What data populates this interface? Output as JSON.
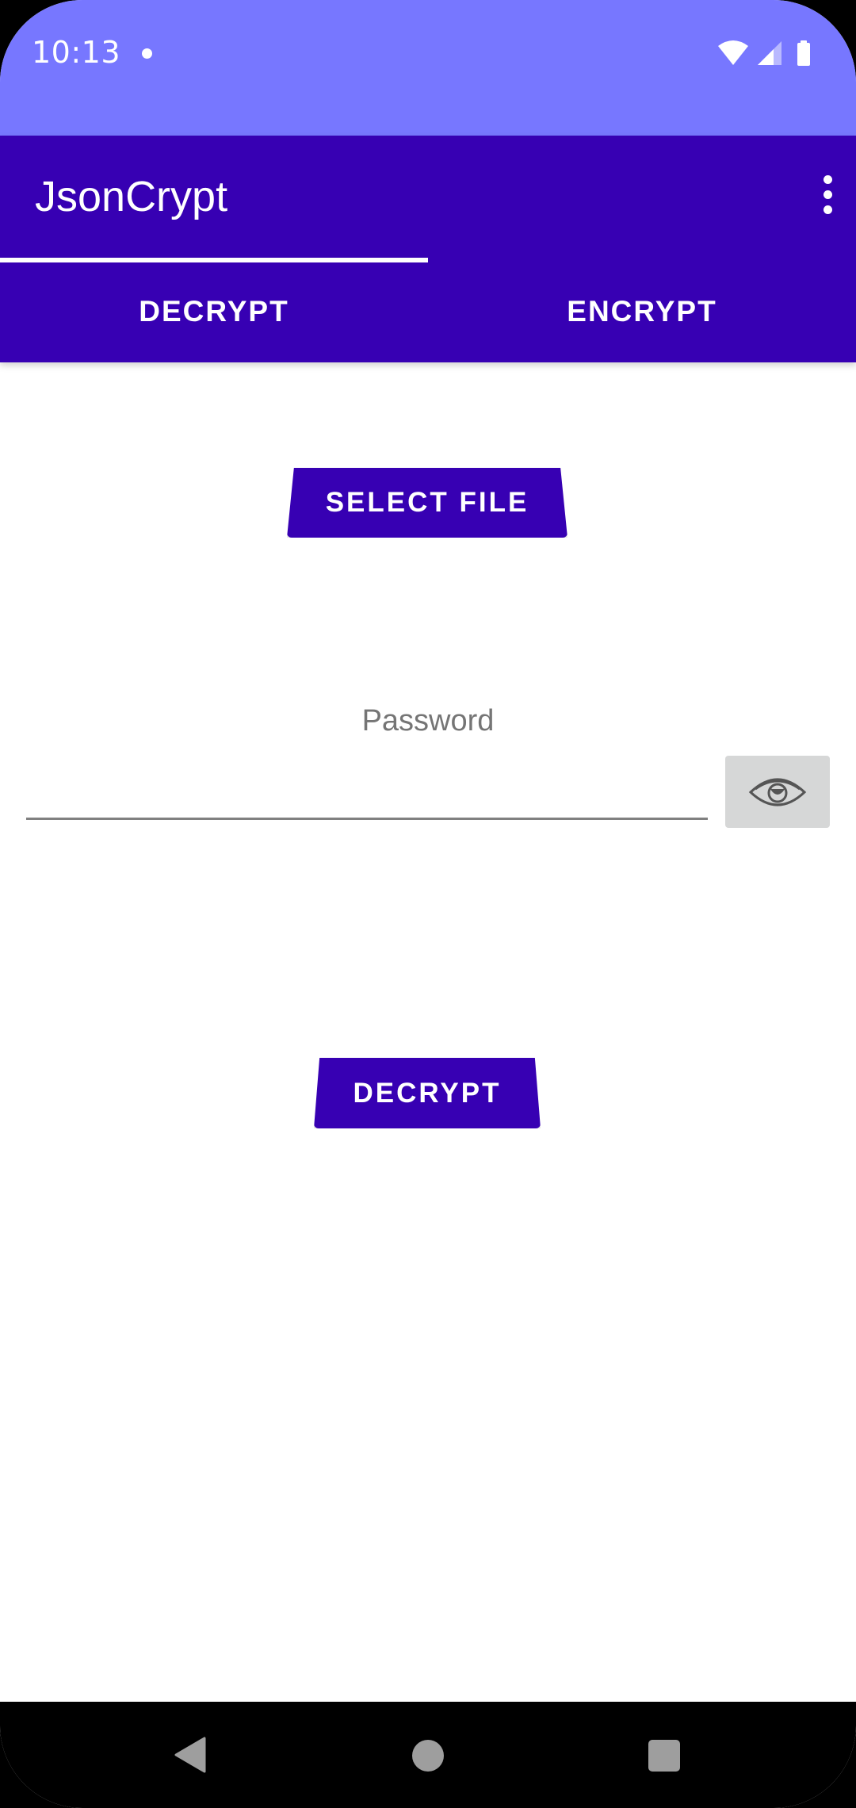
{
  "status_bar": {
    "time": "10:13",
    "icons": [
      "notification-dot-icon",
      "wifi-icon",
      "signal-icon",
      "battery-icon"
    ]
  },
  "app_bar": {
    "title": "JsonCrypt",
    "menu_icon": "more-vert-icon"
  },
  "tabs": [
    {
      "label": "DECRYPT",
      "selected": true
    },
    {
      "label": "ENCRYPT",
      "selected": false
    }
  ],
  "content": {
    "select_file_label": "SELECT FILE",
    "password_label": "Password",
    "password_value": "",
    "visibility_toggle_icon": "eye-icon",
    "decrypt_label": "DECRYPT"
  },
  "navigation_bar": {
    "icons": [
      "back-icon",
      "home-icon",
      "recents-icon"
    ]
  },
  "colors": {
    "status_bar": "#7777ff",
    "primary": "#3700b3",
    "toggle_background": "#d6d7d7",
    "label_gray": "#757575"
  }
}
